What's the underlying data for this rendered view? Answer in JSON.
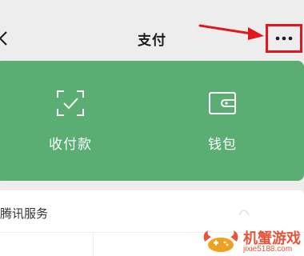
{
  "header": {
    "title": "支付",
    "back_icon": "chevron-left-icon",
    "more_icon": "more-horizontal-icon"
  },
  "annotation": {
    "arrow_color": "#e0181e",
    "highlight_color": "#e0181e"
  },
  "payment_card": {
    "background": "#5aad73",
    "items": [
      {
        "label": "收付款",
        "icon": "scan-check-icon"
      },
      {
        "label": "钱包",
        "icon": "wallet-icon"
      }
    ]
  },
  "services": {
    "title": "腾讯服务"
  },
  "watermark": {
    "brand": "机蟹游戏",
    "domain": "jixie5188.com",
    "color": "#e6553a"
  }
}
